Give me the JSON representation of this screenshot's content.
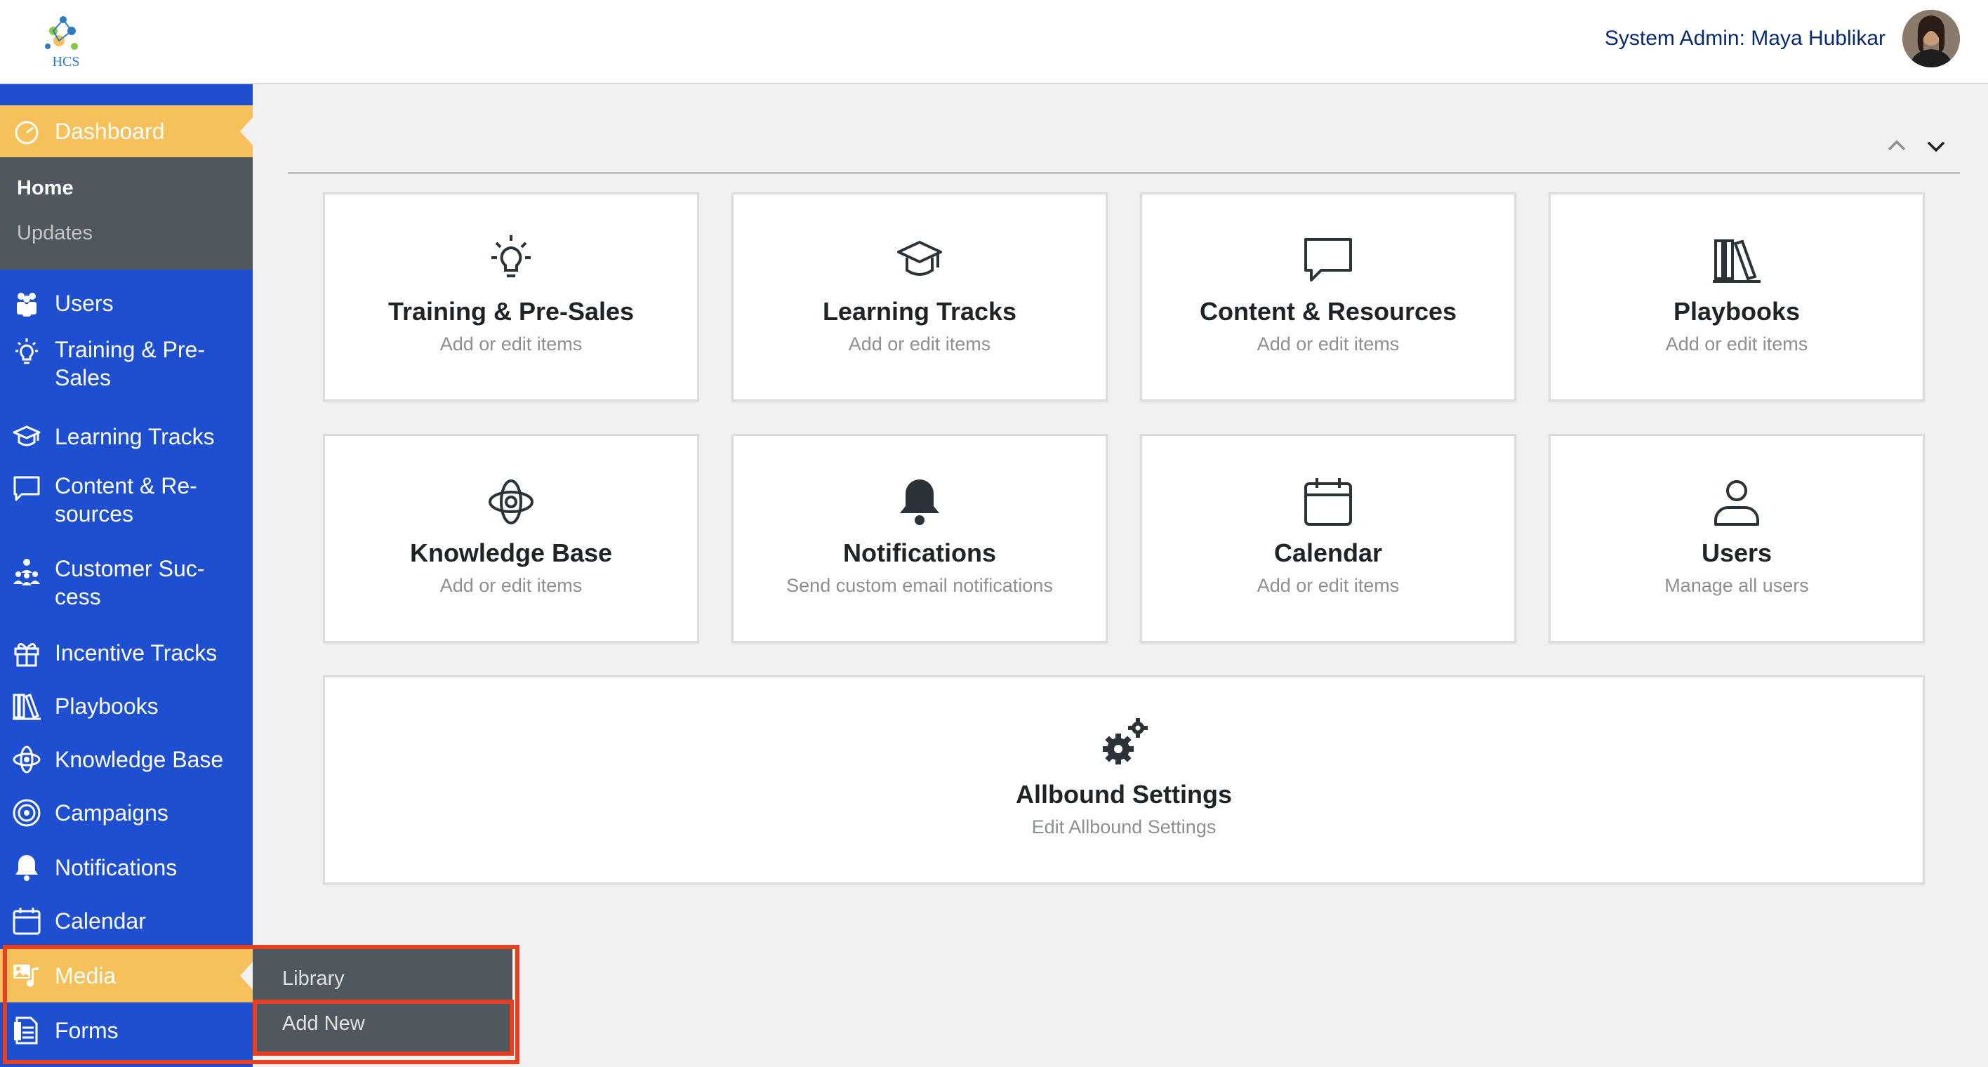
{
  "header": {
    "admin_label": "System Admin: Maya Hublikar",
    "logo_text": "HCS"
  },
  "colors": {
    "sidebar": "#1f4fd1",
    "active": "#f6c15a",
    "submenu": "#50575e",
    "highlight": "#e8401f"
  },
  "sidebar": {
    "dashboard": {
      "label": "Dashboard",
      "icon": "dashboard-icon"
    },
    "dashboard_sub": {
      "home": "Home",
      "updates": "Updates"
    },
    "items": [
      {
        "label": "Users",
        "icon": "users-icon"
      },
      {
        "label": "Training & Pre-\nSales",
        "icon": "lightbulb-icon"
      },
      {
        "label": "Learning Tracks",
        "icon": "graduation-cap-icon"
      },
      {
        "label": "Content & Re-\nsources",
        "icon": "speech-bubble-icon"
      },
      {
        "label": "Customer Suc-\ncess",
        "icon": "org-chart-icon"
      },
      {
        "label": "Incentive Tracks",
        "icon": "gift-icon"
      },
      {
        "label": "Playbooks",
        "icon": "books-icon"
      },
      {
        "label": "Knowledge Base",
        "icon": "atom-icon"
      },
      {
        "label": "Campaigns",
        "icon": "target-icon"
      },
      {
        "label": "Notifications",
        "icon": "bell-icon"
      },
      {
        "label": "Calendar",
        "icon": "calendar-icon"
      },
      {
        "label": "Media",
        "icon": "media-icon"
      },
      {
        "label": "Forms",
        "icon": "forms-icon"
      }
    ],
    "media_flyout": {
      "library": "Library",
      "add_new": "Add New"
    }
  },
  "cards": [
    {
      "title": "Training & Pre-Sales",
      "subtitle": "Add or edit items",
      "icon": "lightbulb-icon"
    },
    {
      "title": "Learning Tracks",
      "subtitle": "Add or edit items",
      "icon": "graduation-cap-icon"
    },
    {
      "title": "Content & Resources",
      "subtitle": "Add or edit items",
      "icon": "speech-bubble-icon"
    },
    {
      "title": "Playbooks",
      "subtitle": "Add or edit items",
      "icon": "books-icon"
    },
    {
      "title": "Knowledge Base",
      "subtitle": "Add or edit items",
      "icon": "atom-icon"
    },
    {
      "title": "Notifications",
      "subtitle": "Send custom email notifications",
      "icon": "bell-icon"
    },
    {
      "title": "Calendar",
      "subtitle": "Add or edit items",
      "icon": "calendar-icon"
    },
    {
      "title": "Users",
      "subtitle": "Manage all users",
      "icon": "user-icon"
    },
    {
      "title": "Allbound Settings",
      "subtitle": "Edit Allbound Settings",
      "icon": "gears-icon"
    }
  ]
}
